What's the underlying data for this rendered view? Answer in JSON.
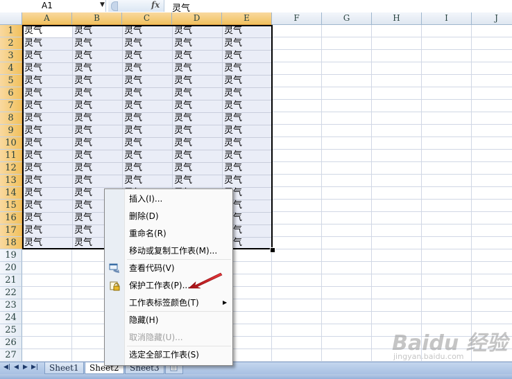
{
  "formula_bar": {
    "name_box": "A1",
    "fx_label": "fx",
    "formula_value": "灵气"
  },
  "columns": [
    "A",
    "B",
    "C",
    "D",
    "E",
    "F",
    "G",
    "H",
    "I",
    "J"
  ],
  "rows": [
    "1",
    "2",
    "3",
    "4",
    "5",
    "6",
    "7",
    "8",
    "9",
    "10",
    "11",
    "12",
    "13",
    "14",
    "15",
    "16",
    "17",
    "18",
    "19",
    "20",
    "21",
    "22",
    "23",
    "24",
    "25",
    "26",
    "27"
  ],
  "cell_text": "灵气",
  "filled_range": {
    "columns": [
      "A",
      "B",
      "C",
      "D",
      "E"
    ],
    "last_row": 18
  },
  "sheet_tabs": [
    "Sheet1",
    "Sheet2",
    "Sheet3"
  ],
  "active_sheet": "Sheet2",
  "context_menu": {
    "items": [
      {
        "label": "插入(I)...",
        "icon": null,
        "disabled": false,
        "submenu": false
      },
      {
        "label": "删除(D)",
        "icon": null,
        "disabled": false,
        "submenu": false
      },
      {
        "label": "重命名(R)",
        "icon": null,
        "disabled": false,
        "submenu": false
      },
      {
        "label": "移动或复制工作表(M)...",
        "icon": null,
        "disabled": false,
        "submenu": false
      },
      {
        "label": "查看代码(V)",
        "icon": "view-code-icon",
        "disabled": false,
        "submenu": false
      },
      {
        "label": "保护工作表(P)...",
        "icon": "protect-sheet-icon",
        "disabled": false,
        "submenu": false
      },
      {
        "label": "工作表标签颜色(T)",
        "icon": null,
        "disabled": false,
        "submenu": true
      },
      {
        "label": "隐藏(H)",
        "icon": null,
        "disabled": false,
        "submenu": false
      },
      {
        "label": "取消隐藏(U)...",
        "icon": null,
        "disabled": true,
        "submenu": false
      },
      {
        "label": "选定全部工作表(S)",
        "icon": null,
        "disabled": false,
        "submenu": false
      }
    ]
  },
  "watermark": {
    "brand": "Baidu 经验",
    "sub": "jingyan.baidu.com"
  },
  "colors": {
    "selection_fill": "#eaedf7",
    "header_selected": "#f1c15f",
    "arrow_red": "#d8161b"
  }
}
